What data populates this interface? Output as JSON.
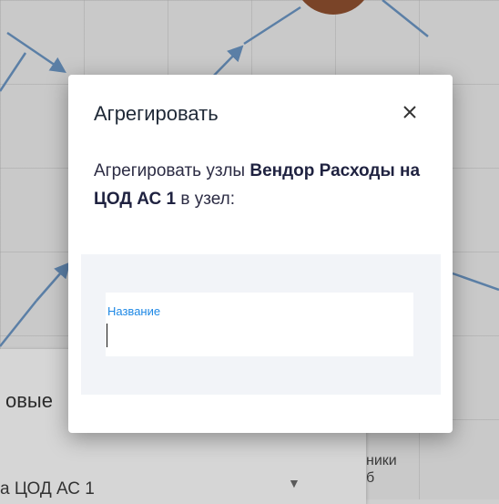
{
  "modal": {
    "title": "Агрегировать",
    "close_icon": "close-icon",
    "message_prefix": "Агрегировать узлы ",
    "node_name": "Вендор Расходы на ЦОД АС 1",
    "message_suffix": " в узел:",
    "name_field": {
      "label": "Название",
      "value": ""
    }
  },
  "background": {
    "panel_title": "овые",
    "select_value": "а ЦОД АС 1",
    "select_icon": "dropdown-arrow-icon",
    "side_text_1": "ники",
    "side_text_2": "б"
  },
  "colors": {
    "accent": "#1e88e5",
    "overlay": "#c9c9c9",
    "edge": "#5b7fa6",
    "node": "#7a4428",
    "form_bg": "#f2f4f8"
  }
}
